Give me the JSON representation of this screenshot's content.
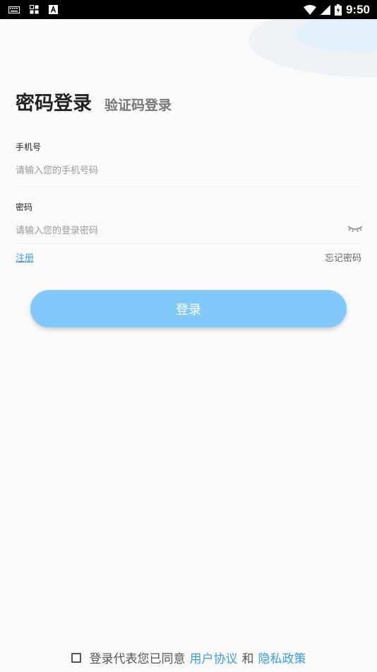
{
  "status_bar": {
    "time": "9:50"
  },
  "tabs": {
    "password_login": "密码登录",
    "code_login": "验证码登录"
  },
  "phone": {
    "label": "手机号",
    "placeholder": "请输入您的手机号码"
  },
  "password": {
    "label": "密码",
    "placeholder": "请输入您的登录密码"
  },
  "links": {
    "register": "注册",
    "forgot": "忘记密码"
  },
  "login_button": "登录",
  "agreement": {
    "prefix": "登录代表您已同意",
    "user_agreement": "用户协议",
    "and": "和",
    "privacy_policy": "隐私政策"
  },
  "colors": {
    "accent": "#3a9be8",
    "button": "#82c9fb",
    "background": "#fafafa"
  }
}
